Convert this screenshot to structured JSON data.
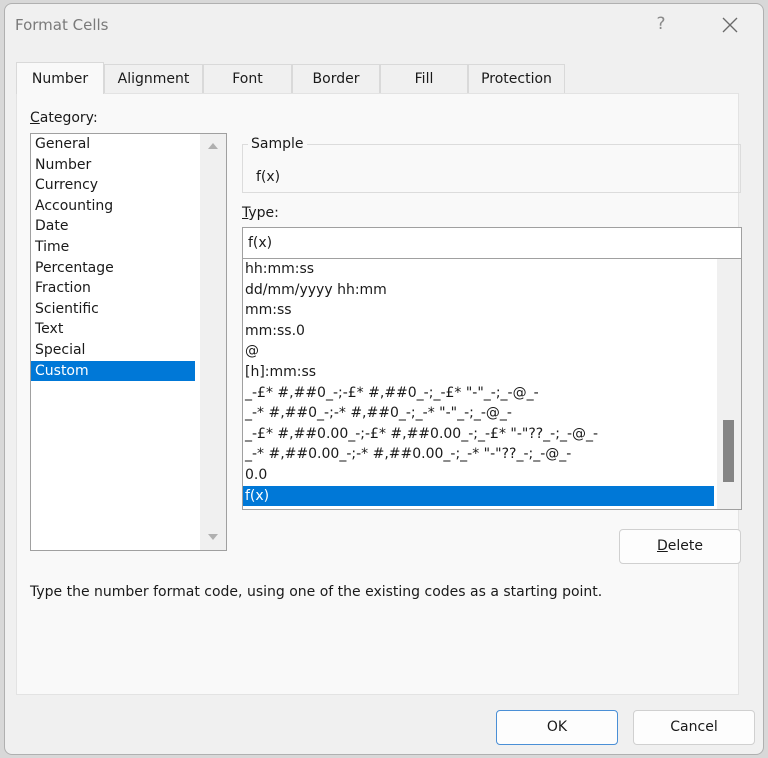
{
  "window": {
    "title": "Format Cells",
    "help_label": "?",
    "close_icon": "close-icon"
  },
  "tabs": [
    {
      "label": "Number",
      "active": true
    },
    {
      "label": "Alignment",
      "active": false
    },
    {
      "label": "Font",
      "active": false
    },
    {
      "label": "Border",
      "active": false
    },
    {
      "label": "Fill",
      "active": false
    },
    {
      "label": "Protection",
      "active": false
    }
  ],
  "category": {
    "label_accel": "C",
    "label_rest": "ategory:",
    "items": [
      "General",
      "Number",
      "Currency",
      "Accounting",
      "Date",
      "Time",
      "Percentage",
      "Fraction",
      "Scientific",
      "Text",
      "Special",
      "Custom"
    ],
    "selected": "Custom"
  },
  "sample": {
    "legend": "Sample",
    "value": "f(x)"
  },
  "type": {
    "label_accel": "T",
    "label_rest": "ype:",
    "value": "f(x)",
    "items": [
      "hh:mm:ss",
      "dd/mm/yyyy hh:mm",
      "mm:ss",
      "mm:ss.0",
      "@",
      "[h]:mm:ss",
      "_-£* #,##0_-;-£* #,##0_-;_-£* \"-\"_-;_-@_-",
      "_-* #,##0_-;-* #,##0_-;_-* \"-\"_-;_-@_-",
      "_-£* #,##0.00_-;-£* #,##0.00_-;_-£* \"-\"??_-;_-@_-",
      "_-* #,##0.00_-;-* #,##0.00_-;_-* \"-\"??_-;_-@_-",
      "0.0",
      "f(x)"
    ],
    "selected": "f(x)",
    "scroll_position_fraction": 0.85
  },
  "buttons": {
    "delete_accel": "D",
    "delete_rest": "elete",
    "ok": "OK",
    "cancel": "Cancel"
  },
  "hint": "Type the number format code, using one of the existing codes as a starting point.",
  "colors": {
    "selection": "#0078d7",
    "primary_border": "#4a8fd6"
  }
}
